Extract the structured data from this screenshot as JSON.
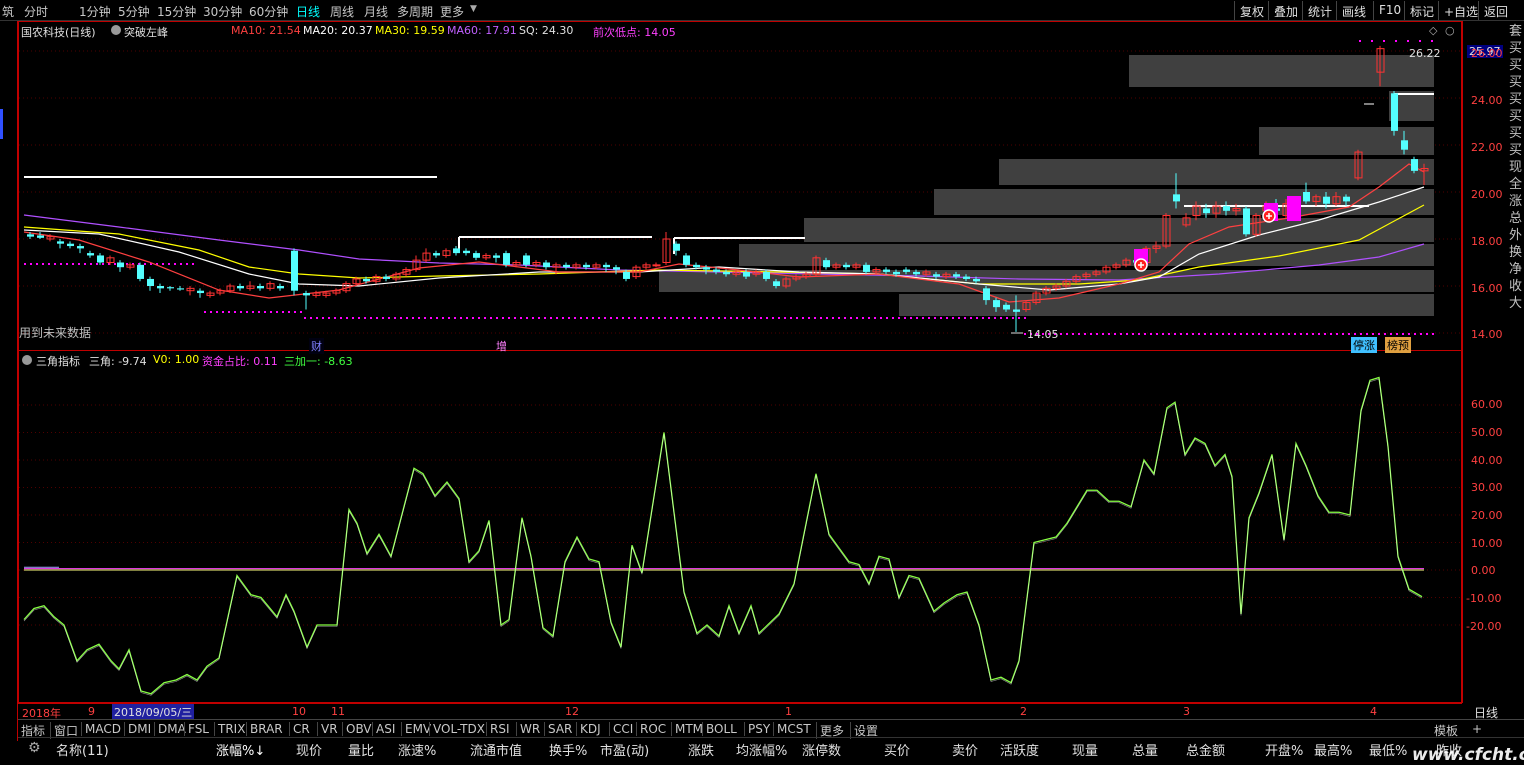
{
  "toolbar": {
    "left_tab": "筑",
    "periods": [
      "分时",
      "1分钟",
      "5分钟",
      "15分钟",
      "30分钟",
      "60分钟",
      "日线",
      "周线",
      "月线",
      "多周期",
      "更多"
    ],
    "active_period": "日线",
    "right_buttons": [
      "复权",
      "叠加",
      "统计",
      "画线",
      "F10",
      "标记",
      "+自选",
      "返回"
    ]
  },
  "main": {
    "stock_name": "国农科技(日线)",
    "formula": "突破左峰",
    "ma10": "MA10: 21.54",
    "ma20": "MA20: 20.37",
    "ma30": "MA30: 19.59",
    "ma60": "MA60: 17.91",
    "sq": "SQ: 24.30",
    "prev_low": "前次低点: 14.05",
    "high_label": "26.22",
    "low_label": "14.05",
    "current_price": "25.97",
    "future_data": "用到未来数据",
    "tag_cai": "财",
    "tag_zeng": "增",
    "tag_tingzhang": "停涨",
    "tag_bangyu": "榜预"
  },
  "indicator": {
    "name": "三角指标",
    "v1": "三角: -9.74",
    "v2": "V0: 1.00",
    "v3": "资金占比: 0.11",
    "v4": "三加一: -8.63"
  },
  "price_ticks": [
    "26.00",
    "24.00",
    "22.00",
    "20.00",
    "18.00",
    "16.00",
    "14.00"
  ],
  "ind_ticks": [
    "60.00",
    "50.00",
    "40.00",
    "30.00",
    "20.00",
    "10.00",
    "0.00",
    "-10.00",
    "-20.00"
  ],
  "date_axis": {
    "year": "2018年",
    "m9": "9",
    "selected": "2018/09/05/三",
    "m10": "10",
    "m11": "11",
    "m12": "12",
    "m1": "1",
    "m2": "2",
    "m3": "3",
    "m4": "4",
    "period_btn": "日线"
  },
  "indicator_tabs": [
    "指标",
    "窗口",
    "MACD",
    "DMI",
    "DMA",
    "FSL",
    "TRIX",
    "BRAR",
    "CR",
    "VR",
    "OBV",
    "ASI",
    "EMV",
    "VOL-TDX",
    "RSI",
    "WR",
    "SAR",
    "KDJ",
    "CCI",
    "ROC",
    "MTM",
    "BOLL",
    "PSY",
    "MCST",
    "更多",
    "设置"
  ],
  "template_btn": "模板",
  "plus_btn": "+",
  "columns": [
    "名称(11)",
    "涨幅%↓",
    "现价",
    "量比",
    "涨速%",
    "流通市值",
    "换手%",
    "市盈(动)",
    "涨跌",
    "均涨幅%",
    "涨停数",
    "买价",
    "卖价",
    "活跃度",
    "现量",
    "总量",
    "总金额",
    "开盘%",
    "最高%",
    "最低%",
    "昨收"
  ],
  "right_vertical": "套买买买买买买买现全涨总外换净收大",
  "watermark": "www.cfcht.com",
  "colors": {
    "up": "#ff3232",
    "down": "#54ffff",
    "ma10": "#ff4040",
    "ma20": "#ffffff",
    "ma30": "#ffff00",
    "ma60": "#b050ff",
    "indicator_line": "#88ff44",
    "border": "#c00000",
    "accent_magenta": "#ff00ff"
  }
}
